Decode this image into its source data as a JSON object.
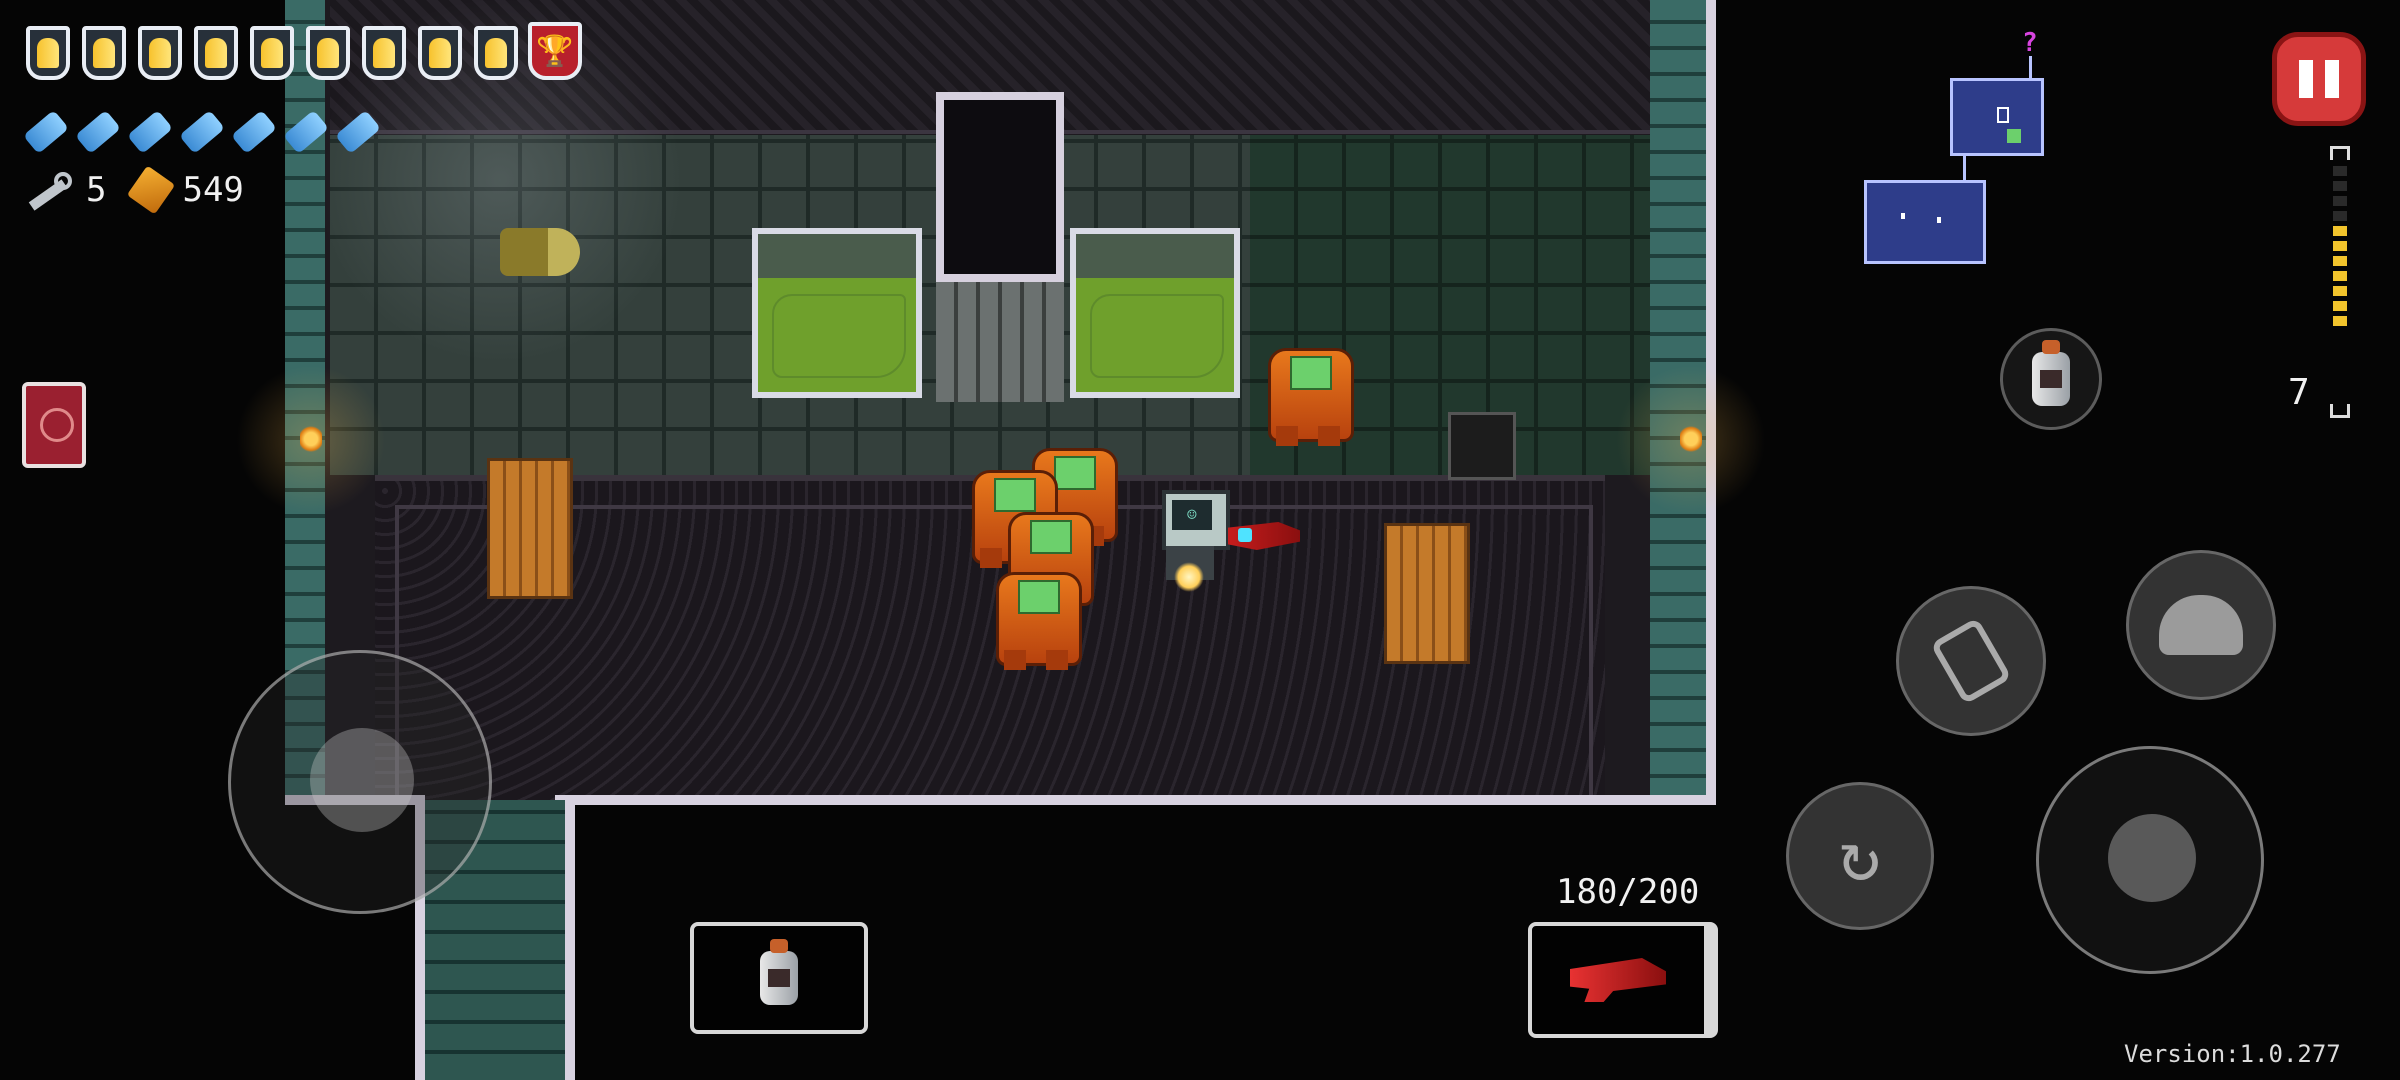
{
  "hud": {
    "hearts": [
      {
        "type": "heart-armor"
      },
      {
        "type": "heart-armor"
      },
      {
        "type": "heart-armor"
      },
      {
        "type": "heart-armor"
      },
      {
        "type": "heart-armor"
      },
      {
        "type": "heart-armor"
      },
      {
        "type": "heart-armor"
      },
      {
        "type": "heart-armor"
      },
      {
        "type": "heart-armor"
      },
      {
        "type": "heart-armor"
      }
    ],
    "special_armor_icon": "chalice-shield-icon",
    "blanks_count": 7,
    "keys": "5",
    "shells": "549",
    "active_item_count": "7",
    "colors": {
      "hud_text": "#f1f1f1",
      "pause_button": "#d63a3a",
      "ammo_full": "#f2c42c",
      "minimap_room": "#2e3d8a"
    }
  },
  "minimap": {
    "unknown_marker": "?",
    "rooms": [
      "current-room",
      "explored-room"
    ]
  },
  "weapon": {
    "ammo": "180/200",
    "icon": "red-raygun-icon",
    "clip_segments_filled": 7,
    "clip_segments_total": 11
  },
  "active_item": {
    "icon": "canteen-icon"
  },
  "version": "Version:1.0.277",
  "enemies": [
    "gun-nut",
    "gun-nut",
    "gun-nut",
    "gun-nut",
    "gun-nut"
  ],
  "player": {
    "name": "robot"
  }
}
